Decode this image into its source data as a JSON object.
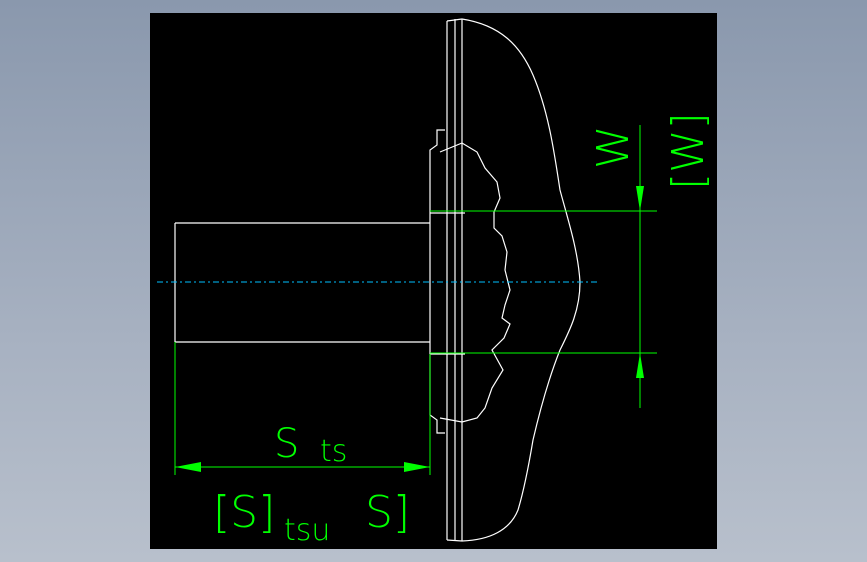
{
  "colors": {
    "background": "#9aa6b8",
    "canvas": "#000000",
    "outline": "#ffffff",
    "dimension": "#00ff00",
    "centerline": "#00bfff"
  },
  "labels": {
    "sts_main": "S",
    "sts_sub": "ts",
    "s_bracket_open": "[S]",
    "s_sub_tsu": "tsu",
    "s_bracket_close": "S]",
    "w_label": "W",
    "w_bracket": "[W]"
  }
}
